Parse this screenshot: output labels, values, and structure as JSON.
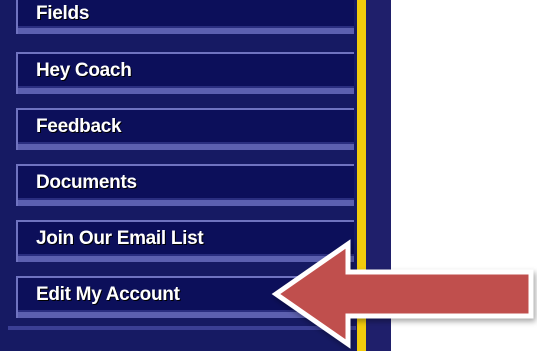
{
  "sidebar": {
    "items": [
      {
        "label": "Fields"
      },
      {
        "label": "Hey Coach"
      },
      {
        "label": "Feedback"
      },
      {
        "label": "Documents"
      },
      {
        "label": "Join Our Email List"
      },
      {
        "label": "Edit My Account"
      }
    ]
  },
  "annotation": {
    "arrow_icon": "left-arrow-icon",
    "arrow_color": "#c0504d"
  },
  "colors": {
    "nav_background": "#0c0f5a",
    "sidebar_background": "#161a63",
    "stripe": "#f2cc0c"
  }
}
